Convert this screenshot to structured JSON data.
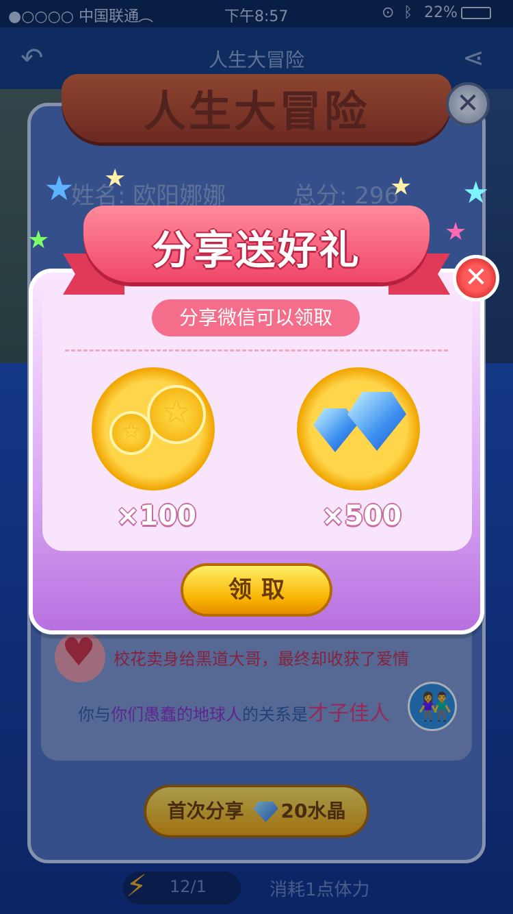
{
  "status_bar": {
    "carrier": "●○○○○ 中国联通",
    "time": "下午8:57",
    "battery": "22%"
  },
  "nav": {
    "title": "人生大冒险",
    "back_icon": "back-arrow-icon",
    "share_icon": "share-icon"
  },
  "main_card": {
    "banner_title": "人生大冒险",
    "name_label": "姓名: 欧阳娜娜",
    "score_label": "总分: 296",
    "story_text": "校花卖身给黑道大哥，最终却收获了爱情",
    "relation_prefix": "你与",
    "relation_target": "你们愚蠢的地球人",
    "relation_mid": "的关系是",
    "relation_result": "才子佳人"
  },
  "bottom": {
    "share_first_label": "首次分享",
    "share_first_reward": "20水晶",
    "energy_value": "12/1",
    "cost_text": "消耗1点体力"
  },
  "popup": {
    "ribbon_title": "分享送好礼",
    "subtitle": "分享微信可以领取",
    "rewards": [
      {
        "name": "coins",
        "qty": "×100"
      },
      {
        "name": "crystals",
        "qty": "×500"
      }
    ],
    "claim_label": "领取"
  },
  "colors": {
    "popup_pink": "#f46e8c",
    "ribbon_red": "#f0466a",
    "gold": "#f7b200",
    "navy": "#0d2f6a"
  }
}
